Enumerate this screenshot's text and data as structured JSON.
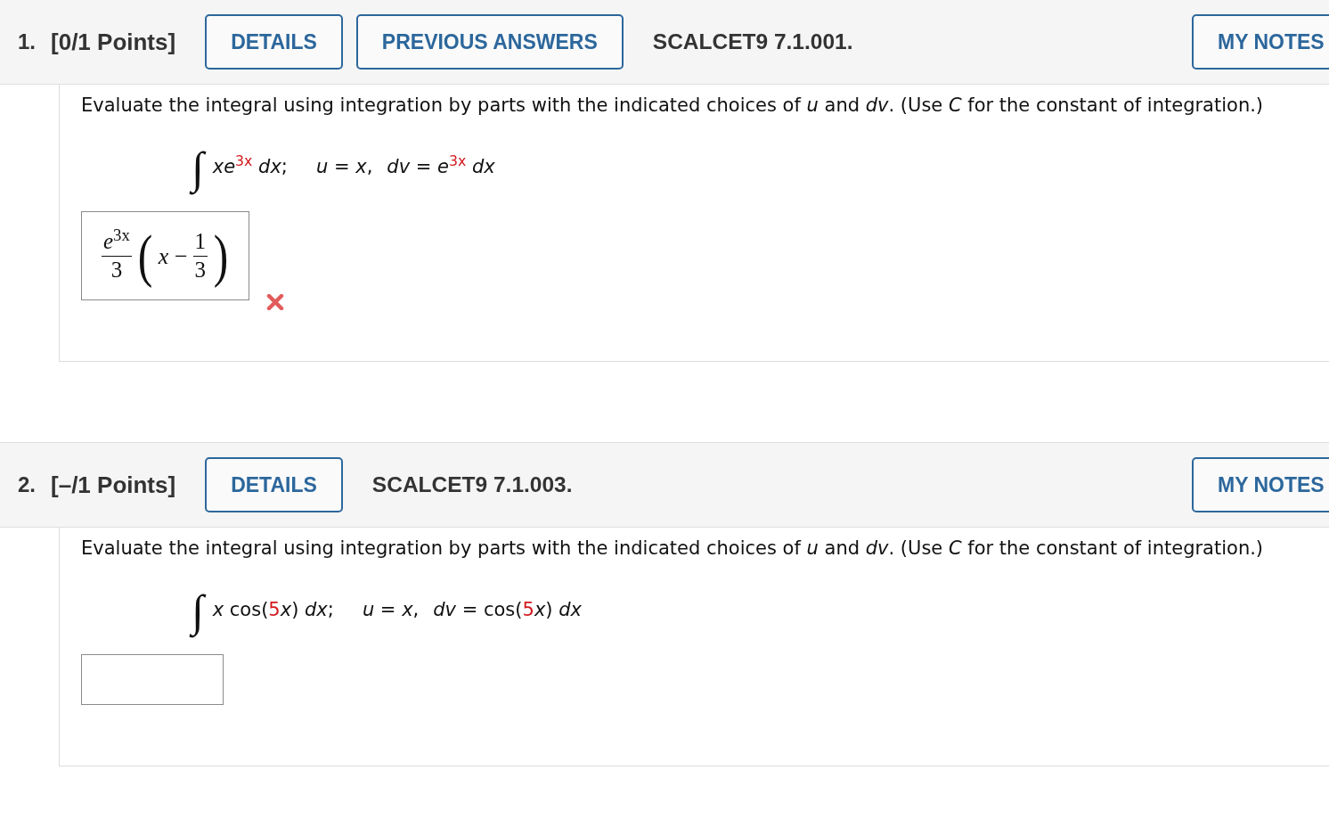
{
  "questions": [
    {
      "number": "1.",
      "points": "[0/1 Points]",
      "buttons": [
        "DETAILS",
        "PREVIOUS ANSWERS"
      ],
      "problem_id": "SCALCET9 7.1.001.",
      "notes_button": "MY NOTES",
      "instructions": "Evaluate the integral using integration by parts with the indicated choices of *u* and *dv*. (Use *C* for the constant of integration.)",
      "integral_sign": "∫",
      "integrand": [
        {
          "text": "*xe*",
          "highlight": false
        },
        {
          "text": "$^{3x}$",
          "highlight": true
        },
        {
          "text": " *dx*;",
          "highlight": false
        }
      ],
      "choices": [
        [
          {
            "text": "*u* = *x*,",
            "highlight": false
          }
        ],
        [
          {
            "text": "*dv* = *e*",
            "highlight": false
          },
          {
            "text": "$^{3x}$",
            "highlight": true
          },
          {
            "text": " *dx*",
            "highlight": false
          }
        ]
      ],
      "answer": {
        "kind": "math",
        "value": [
          {
            "kind": "fraction",
            "numerator": "*e*$^{3x}$",
            "denominator": "3"
          },
          {
            "kind": "paren",
            "text": "("
          },
          {
            "kind": "text",
            "text": "*x* −"
          },
          {
            "kind": "fraction",
            "numerator": "1",
            "denominator": "3"
          },
          {
            "kind": "paren",
            "text": ")"
          }
        ]
      },
      "incorrect": true
    },
    {
      "number": "2.",
      "points": "[–/1 Points]",
      "buttons": [
        "DETAILS"
      ],
      "problem_id": "SCALCET9 7.1.003.",
      "notes_button": "MY NOTES",
      "instructions": "Evaluate the integral using integration by parts with the indicated choices of *u* and *dv*. (Use *C* for the constant of integration.)",
      "integral_sign": "∫",
      "integrand": [
        {
          "text": "*x* cos(",
          "highlight": false
        },
        {
          "text": "5",
          "highlight": true
        },
        {
          "text": "*x*) *dx*;",
          "highlight": false
        }
      ],
      "choices": [
        [
          {
            "text": "*u* = *x*,",
            "highlight": false
          }
        ],
        [
          {
            "text": "*dv* = cos(",
            "highlight": false
          },
          {
            "text": "5",
            "highlight": true
          },
          {
            "text": "*x*) *dx*",
            "highlight": false
          }
        ]
      ],
      "answer": {
        "kind": "blank"
      },
      "incorrect": false
    }
  ]
}
